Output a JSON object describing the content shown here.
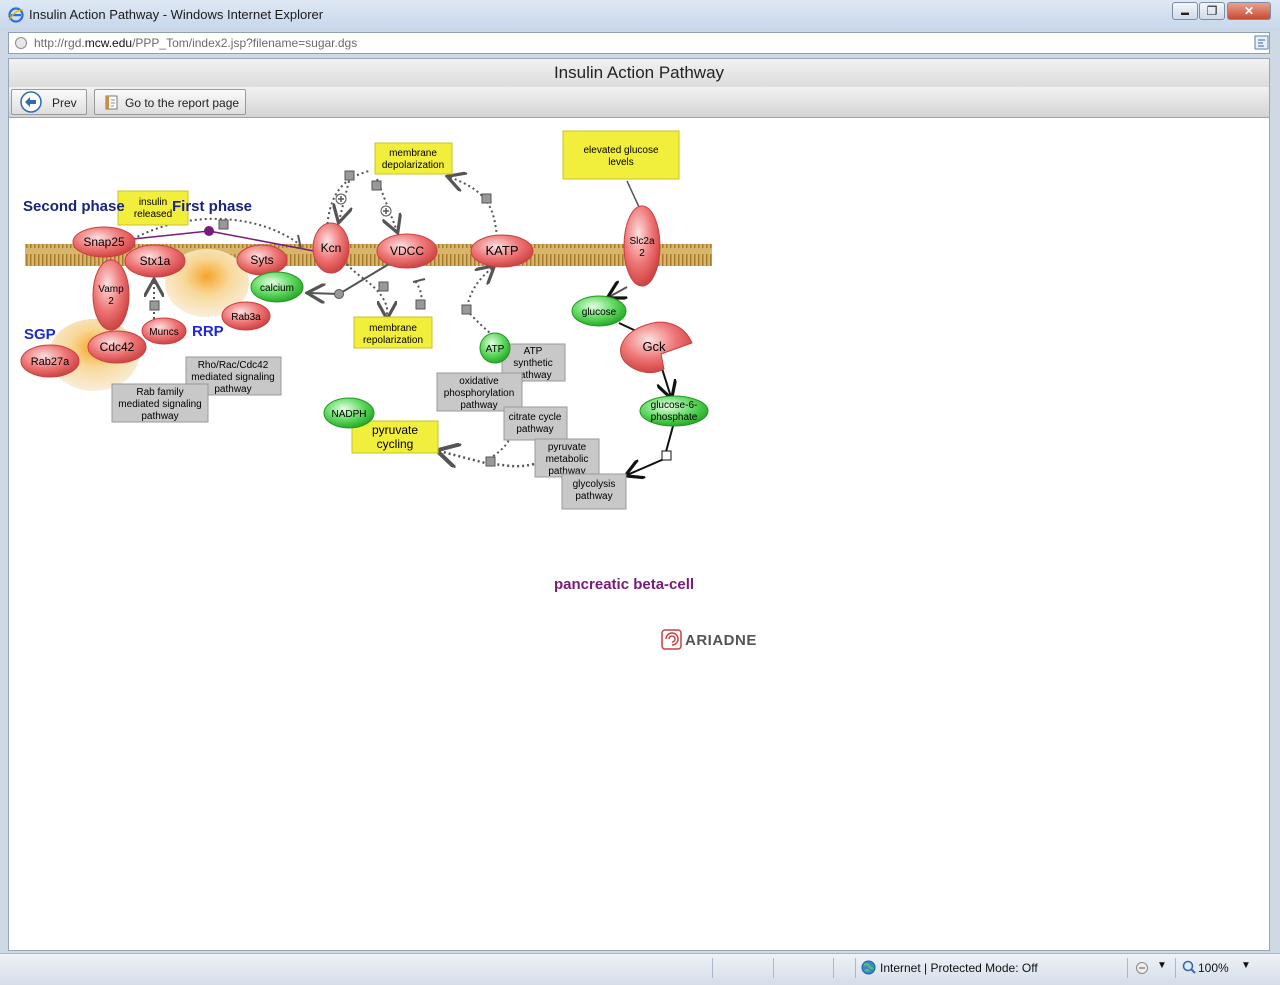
{
  "window": {
    "title": "Insulin Action Pathway - Windows Internet Explorer",
    "minimize": "▬",
    "maximize": "❐",
    "close": "✕"
  },
  "address": {
    "url_prefix": "http://rgd.",
    "url_domain": "mcw.edu",
    "url_suffix": "/PPP_Tom/index2.jsp?filename=sugar.dgs"
  },
  "page": {
    "title": "Insulin Action Pathway"
  },
  "toolbar": {
    "prev_label": "Prev",
    "report_label": "Go to the report page"
  },
  "diagram": {
    "labels": {
      "second_phase": "Second phase",
      "first_phase": "First phase",
      "sgp": "SGP",
      "rrp": "RRP",
      "cell": "pancreatic beta-cell",
      "ariadne": "ARIADNE"
    },
    "proteins": {
      "snap25": "Snap25",
      "stx1a": "Stx1a",
      "syts": "Syts",
      "vamp2_a": "Vamp",
      "vamp2_b": "2",
      "cdc42": "Cdc42",
      "rab27a": "Rab27a",
      "muncs": "Muncs",
      "rab3a": "Rab3a",
      "kcn": "Kcn",
      "vdcc": "VDCC",
      "katp": "KATP",
      "slc2a2_a": "Slc2a",
      "slc2a2_b": "2",
      "gck": "Gck"
    },
    "small_molecules": {
      "calcium": "calcium",
      "glucose": "glucose",
      "atp": "ATP",
      "nadph": "NADPH",
      "g6p_a": "glucose-6-",
      "g6p_b": "phosphate"
    },
    "processes": {
      "insulin_released_a": "insulin",
      "insulin_released_b": "released",
      "membrane_depolarization_a": "membrane",
      "membrane_depolarization_b": "depolarization",
      "elevated_glucose_a": "elevated glucose",
      "elevated_glucose_b": "levels",
      "membrane_repolarization_a": "membrane",
      "membrane_repolarization_b": "repolarization",
      "pyruvate_cycling_a": "pyruvate",
      "pyruvate_cycling_b": "cycling"
    },
    "pathways": {
      "rho_a": "Rho/Rac/Cdc42",
      "rho_b": "mediated signaling",
      "rho_c": "pathway",
      "rab_a": "Rab family",
      "rab_b": "mediated signaling",
      "rab_c": "pathway",
      "atp_a": "ATP",
      "atp_b": "synthetic",
      "atp_c": "pathway",
      "oxphos_a": "oxidative",
      "oxphos_b": "phosphorylation",
      "oxphos_c": "pathway",
      "citrate_a": "citrate cycle",
      "citrate_b": "pathway",
      "pyruvate_a": "pyruvate",
      "pyruvate_b": "metabolic",
      "pyruvate_c": "pathway",
      "glycolysis_a": "glycolysis",
      "glycolysis_b": "pathway"
    }
  },
  "status": {
    "zone": "Internet | Protected Mode: Off",
    "zoom": "100%"
  },
  "colors": {
    "protein": "#e05a5a",
    "small_molecule": "#3cc63c",
    "process": "#f2ee3c",
    "pathway": "#c8c8c8",
    "membrane": "#c89a3c",
    "phase_label": "#1a237e",
    "pool_label": "#1e2ad6",
    "cell_label": "#7a1a7a"
  }
}
